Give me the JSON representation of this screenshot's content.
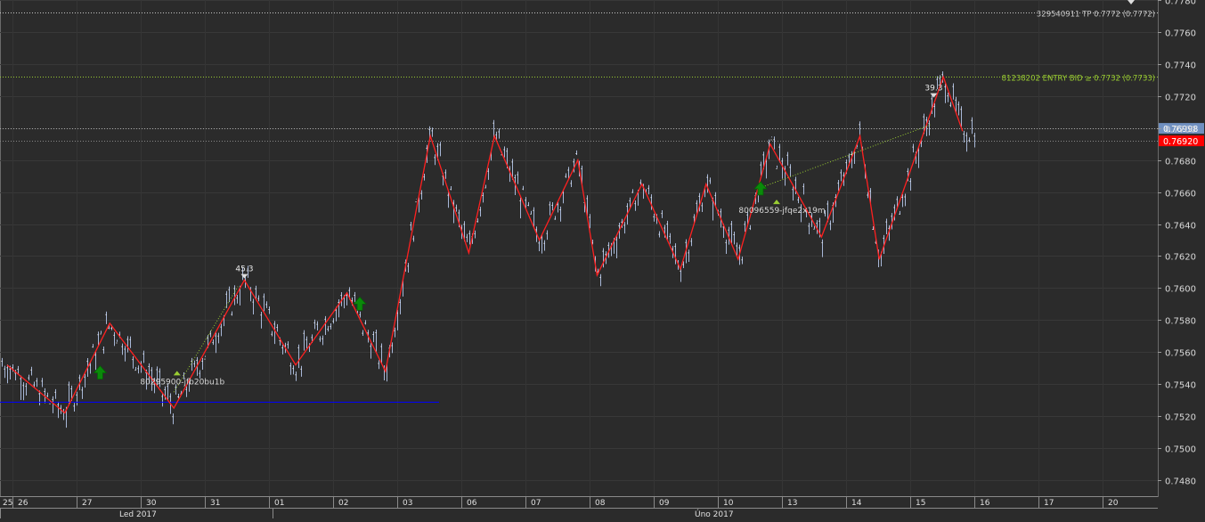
{
  "chart_data": {
    "type": "ohlc",
    "instrument_note": "",
    "y_axis": {
      "min": 0.747,
      "max": 0.778,
      "ticks": [
        "0.7780",
        "0.7760",
        "0.7740",
        "0.7720",
        "0.7700",
        "0.7680",
        "0.7660",
        "0.7640",
        "0.7620",
        "0.7600",
        "0.7580",
        "0.7560",
        "0.7540",
        "0.7520",
        "0.7500",
        "0.7480"
      ],
      "tick_values": [
        0.778,
        0.776,
        0.774,
        0.772,
        0.77,
        0.768,
        0.766,
        0.764,
        0.762,
        0.76,
        0.758,
        0.756,
        0.754,
        0.752,
        0.75,
        0.748
      ]
    },
    "x_axis": {
      "day_labels": [
        "25",
        "26",
        "27",
        "30",
        "31",
        "01",
        "02",
        "03",
        "06",
        "07",
        "08",
        "09",
        "10",
        "13",
        "14",
        "15",
        "16",
        "17",
        "20"
      ],
      "month_labels": [
        "Led 2017",
        "Úno 2017"
      ]
    },
    "price_lines": [
      {
        "label": "329540911 TP 0.7772 (0.7772)",
        "value": 0.7772,
        "color": "#c8c8c8"
      },
      {
        "label": "81238202 ENTRY BID ≥ 0.7732 (0.7733)",
        "value": 0.7732,
        "color": "#9acd32"
      },
      {
        "value": 0.76998,
        "color": "#aaaaaa"
      },
      {
        "value": 0.7692,
        "color": "#888888"
      },
      {
        "value": 0.7529,
        "color": "#0000ff"
      }
    ],
    "price_tags": [
      {
        "label": "0.76998",
        "value": 0.76998,
        "bg": "#7090c0",
        "fg": "#ffffff"
      },
      {
        "label": "0.76920",
        "value": 0.7692,
        "bg": "#ff0000",
        "fg": "#ffffff"
      }
    ],
    "zigzag": [
      {
        "day": 0.0,
        "y": 0.7552
      },
      {
        "day": 0.9,
        "y": 0.7522
      },
      {
        "day": 1.6,
        "y": 0.7578
      },
      {
        "day": 2.6,
        "y": 0.7525
      },
      {
        "day": 3.7,
        "y": 0.7605
      },
      {
        "day": 4.5,
        "y": 0.7552
      },
      {
        "day": 5.3,
        "y": 0.7597
      },
      {
        "day": 5.9,
        "y": 0.7548
      },
      {
        "day": 6.6,
        "y": 0.7695
      },
      {
        "day": 7.2,
        "y": 0.7622
      },
      {
        "day": 7.6,
        "y": 0.7695
      },
      {
        "day": 8.3,
        "y": 0.763
      },
      {
        "day": 8.9,
        "y": 0.768
      },
      {
        "day": 9.2,
        "y": 0.7608
      },
      {
        "day": 9.9,
        "y": 0.7665
      },
      {
        "day": 10.5,
        "y": 0.7612
      },
      {
        "day": 10.9,
        "y": 0.7665
      },
      {
        "day": 11.4,
        "y": 0.7618
      },
      {
        "day": 11.9,
        "y": 0.769
      },
      {
        "day": 12.7,
        "y": 0.7632
      },
      {
        "day": 13.3,
        "y": 0.7695
      },
      {
        "day": 13.6,
        "y": 0.7618
      },
      {
        "day": 14.6,
        "y": 0.7732
      },
      {
        "day": 14.9,
        "y": 0.7698
      }
    ],
    "dotted_lines": [
      {
        "from": {
          "day": 2.6,
          "y": 0.7535
        },
        "to": {
          "day": 3.6,
          "y": 0.7601
        },
        "color": "#9acd32"
      },
      {
        "from": {
          "day": 11.7,
          "y": 0.7662
        },
        "to": {
          "day": 14.4,
          "y": 0.7702
        },
        "color": "#9acd32"
      }
    ],
    "arrows": [
      {
        "day": 1.45,
        "y": 0.7547,
        "dir": "up",
        "color": "#0a8a0a"
      },
      {
        "day": 5.5,
        "y": 0.759,
        "dir": "up",
        "color": "#0a8a0a"
      },
      {
        "day": 11.75,
        "y": 0.7662,
        "dir": "up",
        "color": "#0a8a0a"
      }
    ],
    "markers": [
      {
        "label": "45.3",
        "day": 3.7,
        "y": 0.7606,
        "type": "down-triangle"
      },
      {
        "label": "39.3",
        "day": 14.45,
        "y": 0.7719,
        "type": "down-triangle"
      }
    ],
    "order_labels": [
      {
        "label": "80295900-jfb20bu1b",
        "day": 2.65,
        "y": 0.7541
      },
      {
        "label": "80096559-jfqe2x19m",
        "day": 12.0,
        "y": 0.7648
      }
    ],
    "last_price": 0.7692,
    "grid": true,
    "bar_color": "#a8b8d8"
  }
}
